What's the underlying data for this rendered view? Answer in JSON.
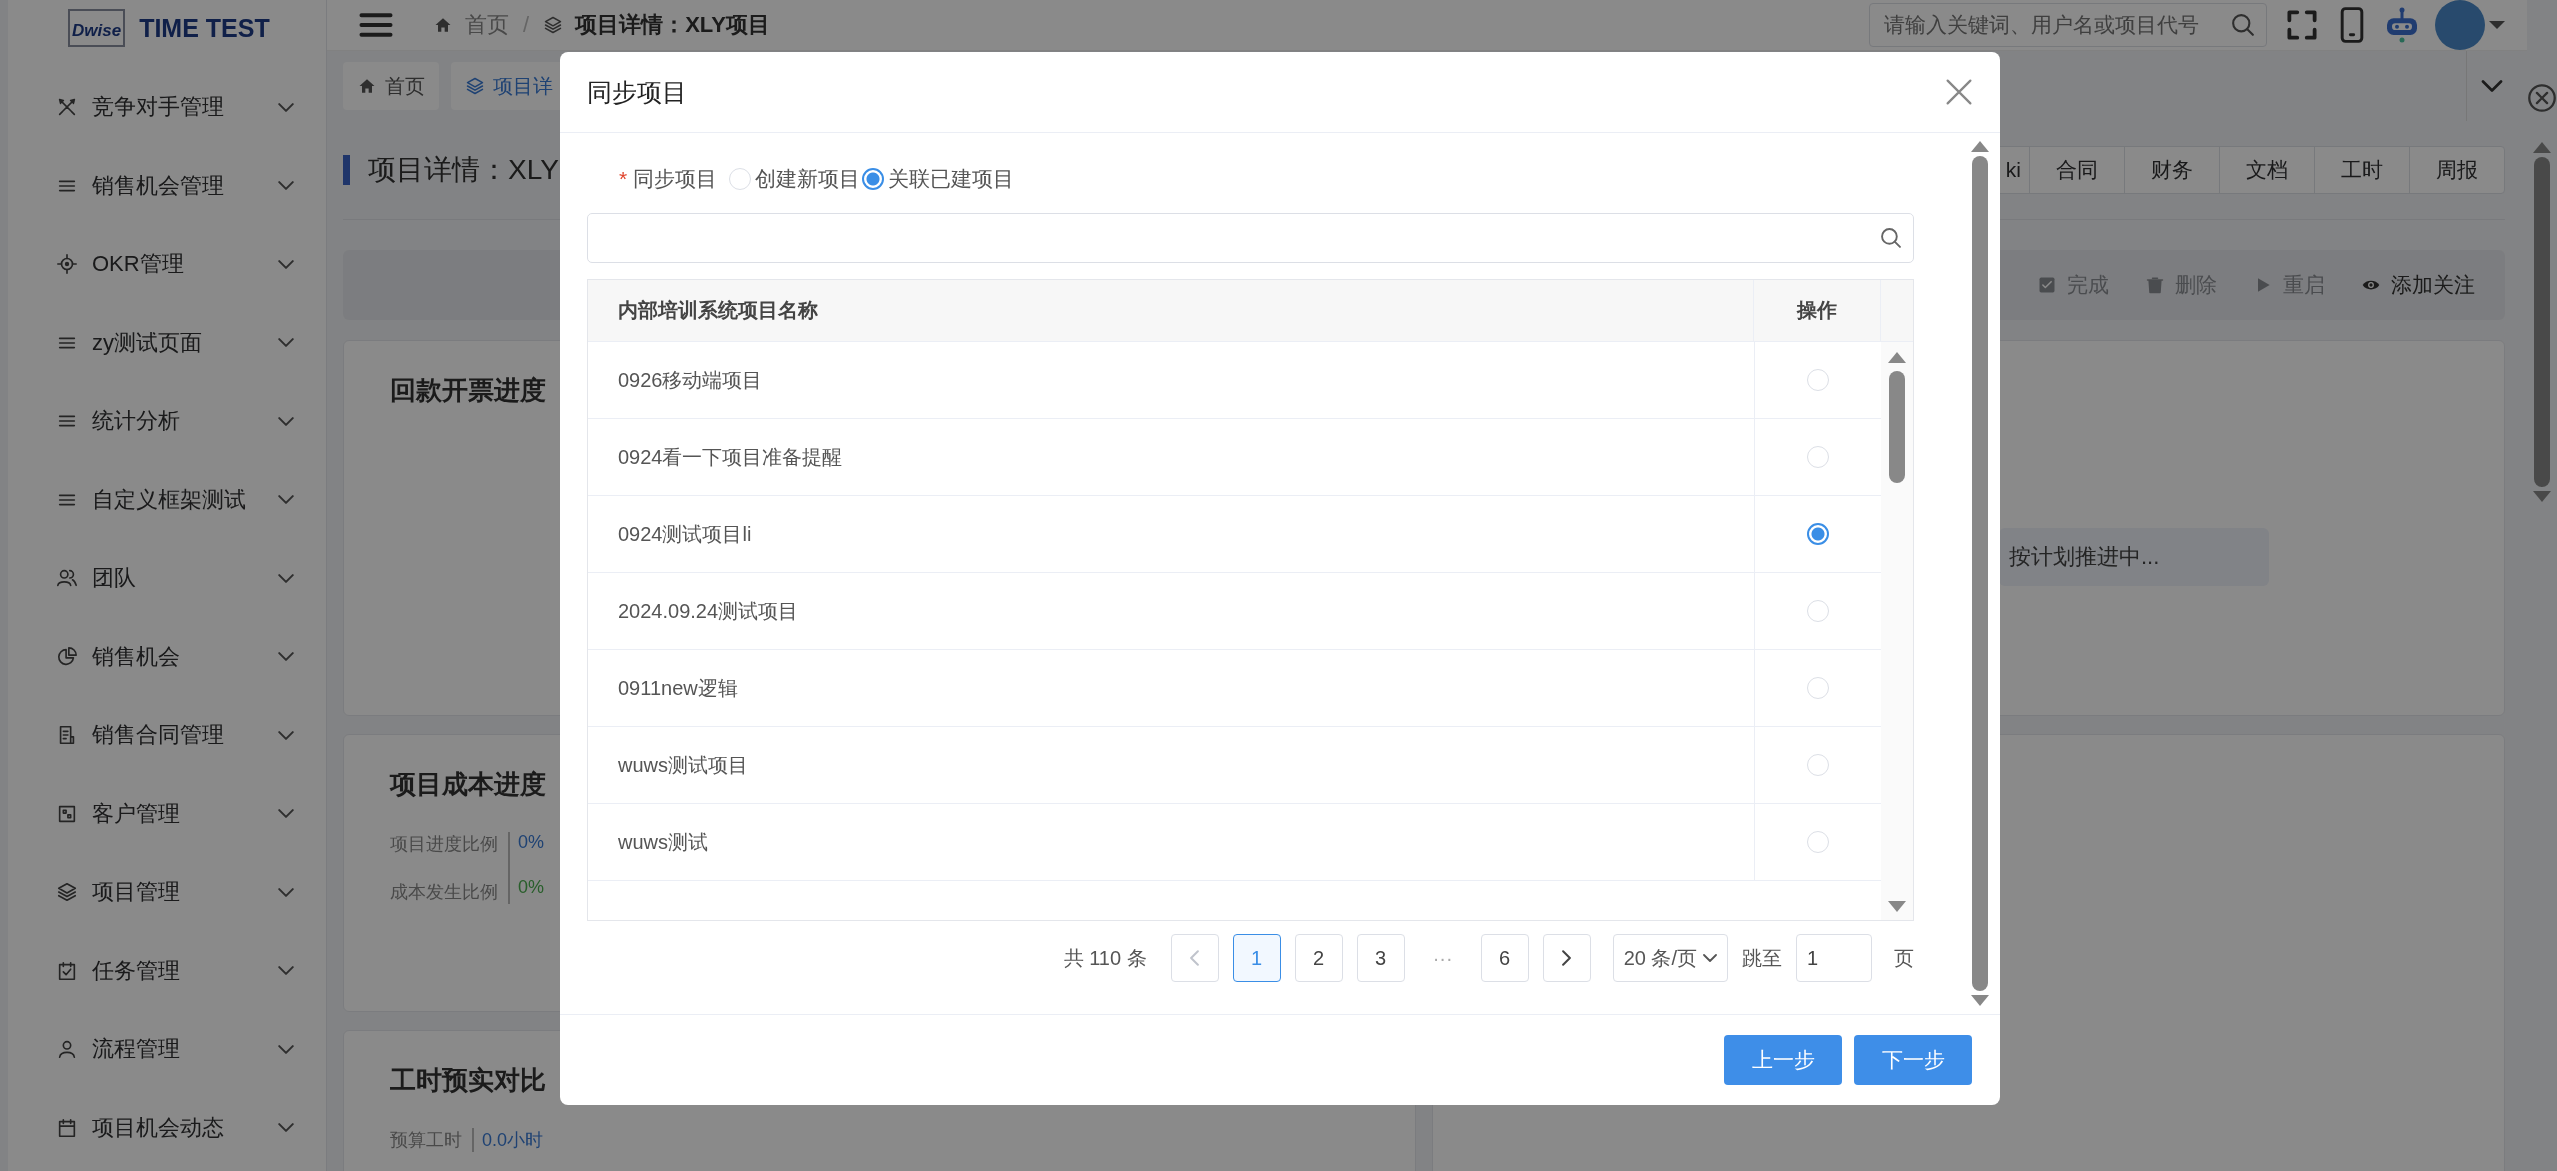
{
  "logo": {
    "mark": "Dwise",
    "title": "TIME TEST"
  },
  "sidebar": {
    "items": [
      {
        "label": "竞争对手管理",
        "kind": "swords"
      },
      {
        "label": "销售机会管理",
        "kind": "lines"
      },
      {
        "label": "OKR管理",
        "kind": "target"
      },
      {
        "label": "zy测试页面",
        "kind": "lines"
      },
      {
        "label": "统计分析",
        "kind": "lines"
      },
      {
        "label": "自定义框架测试",
        "kind": "lines"
      },
      {
        "label": "团队",
        "kind": "team"
      },
      {
        "label": "销售机会",
        "kind": "pie"
      },
      {
        "label": "销售合同管理",
        "kind": "doc"
      },
      {
        "label": "客户管理",
        "kind": "frame"
      },
      {
        "label": "项目管理",
        "kind": "layers"
      },
      {
        "label": "任务管理",
        "kind": "task"
      },
      {
        "label": "流程管理",
        "kind": "user"
      },
      {
        "label": "项目机会动态",
        "kind": "calendar"
      }
    ]
  },
  "header": {
    "separator": "/",
    "breadcrumb": [
      {
        "label": "首页",
        "kind": "home"
      },
      {
        "label": "项目详情：XLY项目",
        "kind": "layers"
      }
    ],
    "search": {
      "placeholder": "请输入关键词、用户名或项目代号"
    }
  },
  "page_tabs": [
    {
      "label": "首页",
      "kind": "home",
      "selected": false
    },
    {
      "label": "项目详",
      "kind": "layers",
      "selected": true
    }
  ],
  "page": {
    "title": "项目详情：XLY",
    "section_tabs": [
      {
        "label": "ki"
      },
      {
        "label": "合同"
      },
      {
        "label": "财务"
      },
      {
        "label": "文档"
      },
      {
        "label": "工时"
      },
      {
        "label": "周报"
      }
    ],
    "actions": [
      {
        "label": "完成",
        "kind": "check",
        "disabled": true
      },
      {
        "label": "删除",
        "kind": "trash",
        "disabled": true
      },
      {
        "label": "重启",
        "kind": "play",
        "disabled": true
      },
      {
        "label": "添加关注",
        "kind": "eye",
        "disabled": false
      }
    ],
    "cards": [
      {
        "title": "回款开票进度"
      },
      {
        "title": "项目成本进度",
        "stats": [
          {
            "label": "项目进度比例",
            "value": "0%"
          },
          {
            "label": "成本发生比例",
            "value": "0%"
          }
        ]
      },
      {
        "title": "工时预实对比",
        "stats": [
          {
            "label": "预算工时",
            "value": "0.0小时"
          }
        ]
      }
    ],
    "status": "按计划推进中..."
  },
  "dialog": {
    "title": "同步项目",
    "field": {
      "required_mark": "*",
      "label": "同步项目",
      "options": [
        {
          "label": "创建新项目",
          "selected": false
        },
        {
          "label": "关联已建项目",
          "selected": true
        }
      ]
    },
    "table": {
      "columns": [
        "内部培训系统项目名称",
        "操作"
      ],
      "rows": [
        {
          "name": "0926移动端项目",
          "selected": false
        },
        {
          "name": "0924看一下项目准备提醒",
          "selected": false
        },
        {
          "name": "0924测试项目li",
          "selected": true
        },
        {
          "name": "2024.09.24测试项目",
          "selected": false
        },
        {
          "name": "0911new逻辑",
          "selected": false
        },
        {
          "name": "wuws测试项目",
          "selected": false
        },
        {
          "name": "wuws测试",
          "selected": false
        }
      ]
    },
    "pagination": {
      "total": "共 110 条",
      "prev_disabled": true,
      "pages": [
        {
          "label": "1",
          "selected": true
        },
        {
          "label": "2",
          "selected": false
        },
        {
          "label": "3",
          "selected": false
        },
        {
          "label": "···",
          "kind": "ellipsis"
        },
        {
          "label": "6",
          "selected": false
        }
      ],
      "next_disabled": false,
      "page_size": "20 条/页",
      "jump_label": "跳至",
      "jump_value": "1",
      "jump_suffix": "页"
    },
    "buttons": [
      {
        "label": "上一步"
      },
      {
        "label": "下一步"
      }
    ]
  }
}
